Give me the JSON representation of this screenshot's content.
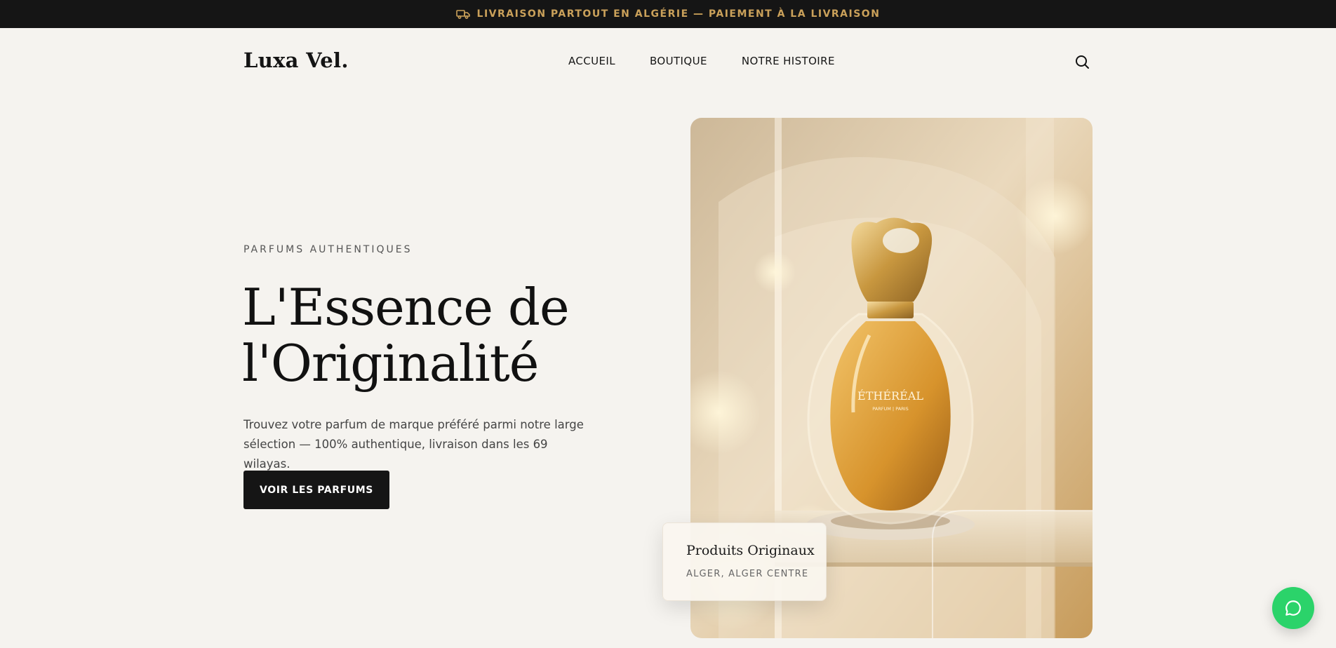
{
  "announcement": {
    "icon": "truck-icon",
    "text": "LIVRAISON PARTOUT EN ALGÉRIE — PAIEMENT À LA LIVRAISON",
    "color": "#caa15a"
  },
  "header": {
    "logo": "Luxa Vel.",
    "nav": [
      {
        "label": "ACCUEIL"
      },
      {
        "label": "BOUTIQUE"
      },
      {
        "label": "NOTRE HISTOIRE"
      }
    ],
    "search_icon": "search-icon"
  },
  "hero": {
    "eyebrow": "PARFUMS AUTHENTIQUES",
    "title_line1": "L'Essence de",
    "title_line2": "l'Originalité",
    "description": "Trouvez votre parfum de marque préféré parmi notre large sélection — 100% authentique, livraison dans les 69 wilayas.",
    "cta_label": "VOIR LES PARFUMS",
    "image": {
      "brand": "ÉTHÉRÉAL",
      "sub": "PARFUM | PARIS"
    },
    "badge": {
      "title": "Produits Originaux",
      "subtitle": "ALGER, ALGER CENTRE"
    }
  },
  "chat": {
    "icon": "chat-bubble-icon",
    "color": "#2bd36a"
  }
}
